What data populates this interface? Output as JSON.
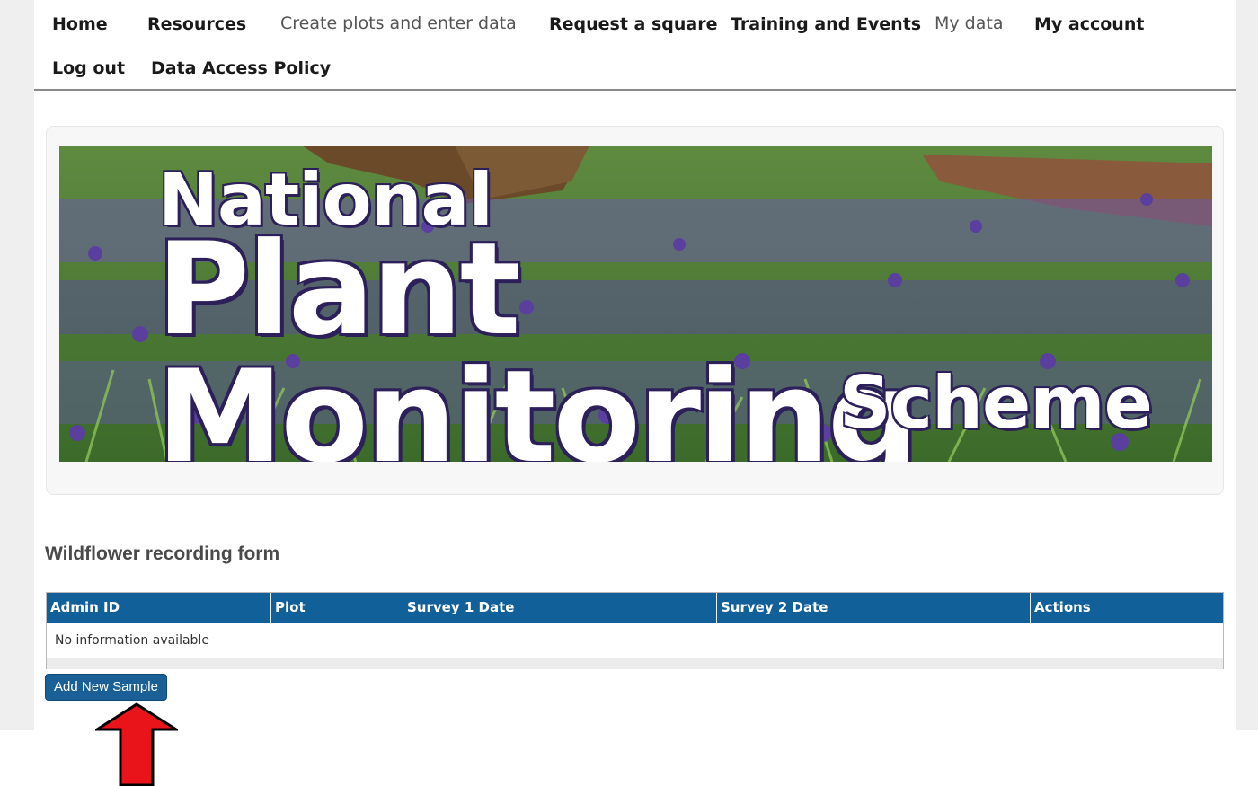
{
  "nav": {
    "items": [
      {
        "label": "Home"
      },
      {
        "label": "Resources"
      },
      {
        "label": "Create plots and enter data"
      },
      {
        "label": "Request a square"
      },
      {
        "label": "Training and Events"
      },
      {
        "label": "My data"
      },
      {
        "label": "My account"
      },
      {
        "label": "Log out"
      },
      {
        "label": "Data Access Policy"
      }
    ]
  },
  "banner": {
    "line1": "National",
    "line2": "Plant Monitoring",
    "line3": "Scheme"
  },
  "form": {
    "heading": "Wildflower recording form",
    "columns": [
      "Admin ID",
      "Plot",
      "Survey 1 Date",
      "Survey 2 Date",
      "Actions"
    ],
    "empty_message": "No information available",
    "add_button": "Add New Sample"
  },
  "colors": {
    "table_header": "#12609a",
    "button": "#1a5f96",
    "arrow": "#e8141a"
  }
}
